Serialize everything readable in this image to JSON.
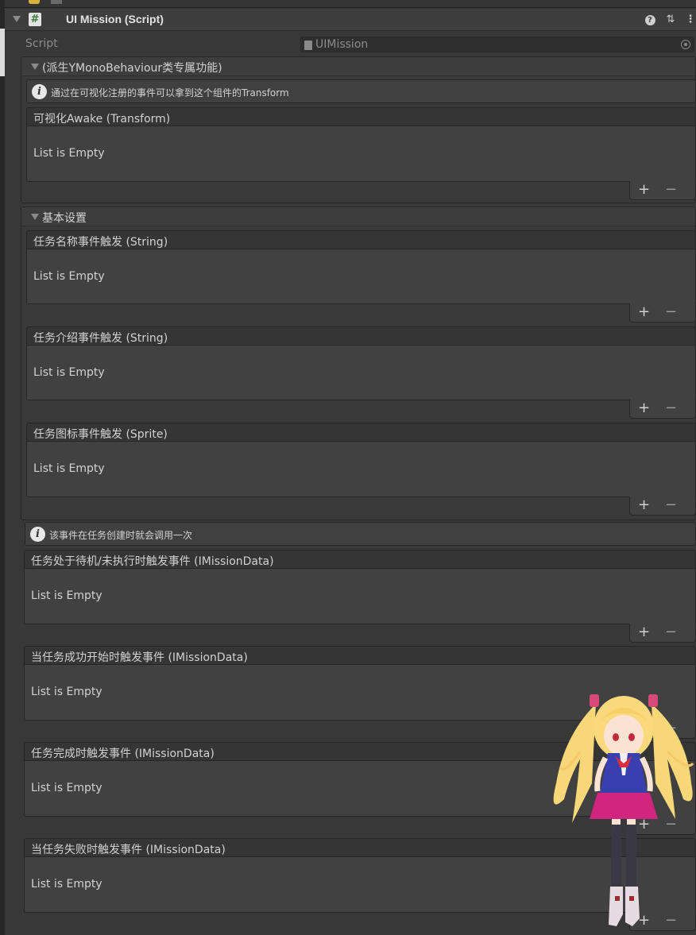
{
  "header": {
    "title": "UI Mission (Script)",
    "script_icon": "#",
    "icons": [
      "help-icon",
      "preset-icon",
      "more-icon"
    ]
  },
  "script_field": {
    "label": "Script",
    "value": "UIMission"
  },
  "group1": {
    "title": "(派生YMonoBehaviour类专属功能)",
    "help": "通过在可视化注册的事件可以拿到这个组件的Transform",
    "events": [
      {
        "title": "可视化Awake (Transform)",
        "empty": "List is Empty"
      }
    ]
  },
  "group2": {
    "title": "基本设置",
    "events": [
      {
        "title": "任务名称事件触发 (String)",
        "empty": "List is Empty"
      },
      {
        "title": "任务介绍事件触发 (String)",
        "empty": "List is Empty"
      },
      {
        "title": "任务图标事件触发 (Sprite)",
        "empty": "List is Empty"
      }
    ]
  },
  "section3": {
    "help": "该事件在任务创建时就会调用一次",
    "events": [
      {
        "title": "任务处于待机/未执行时触发事件 (IMissionData)",
        "empty": "List is Empty"
      },
      {
        "title": "当任务成功开始时触发事件 (IMissionData)",
        "empty": "List is Empty"
      },
      {
        "title": "任务完成时触发事件 (IMissionData)",
        "empty": "List is Empty"
      },
      {
        "title": "当任务失败时触发事件 (IMissionData)",
        "empty": "List is Empty"
      }
    ]
  },
  "footer_buttons": {
    "plus": "+",
    "minus": "−"
  },
  "colors": {
    "background": "#383838",
    "header": "#3e3e3e",
    "list_body": "#414141",
    "list_head": "#353535"
  }
}
